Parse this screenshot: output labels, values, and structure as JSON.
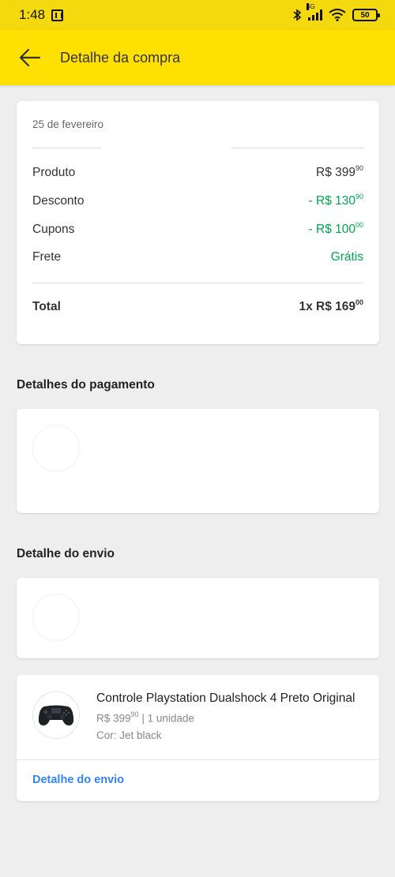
{
  "status_bar": {
    "time": "1:48",
    "network": "4G",
    "battery": "50"
  },
  "app_bar": {
    "title": "Detalhe da compra"
  },
  "summary": {
    "date": "25 de fevereiro",
    "rows": [
      {
        "label": "Produto",
        "value": "R$ 399",
        "cents": "90"
      },
      {
        "label": "Desconto",
        "value": "- R$ 130",
        "cents": "90"
      },
      {
        "label": "Cupons",
        "value": "- R$ 100",
        "cents": "00"
      },
      {
        "label": "Frete",
        "value": "Grátis",
        "cents": ""
      }
    ],
    "total": {
      "label": "Total",
      "value": "1x R$ 169",
      "cents": "00"
    }
  },
  "sections": {
    "payment_title": "Detalhes do pagamento",
    "shipping_title": "Detalhe do envio"
  },
  "product": {
    "name": "Controle Playstation Dualshock 4 Preto Original",
    "price": "R$ 399",
    "price_cents": "90",
    "quantity": "| 1 unidade",
    "color": "Cor: Jet black",
    "link": "Detalhe do envio"
  },
  "colors": {
    "brand_yellow": "#ffe000",
    "discount_green": "#00a650",
    "link_blue": "#3483fa"
  }
}
